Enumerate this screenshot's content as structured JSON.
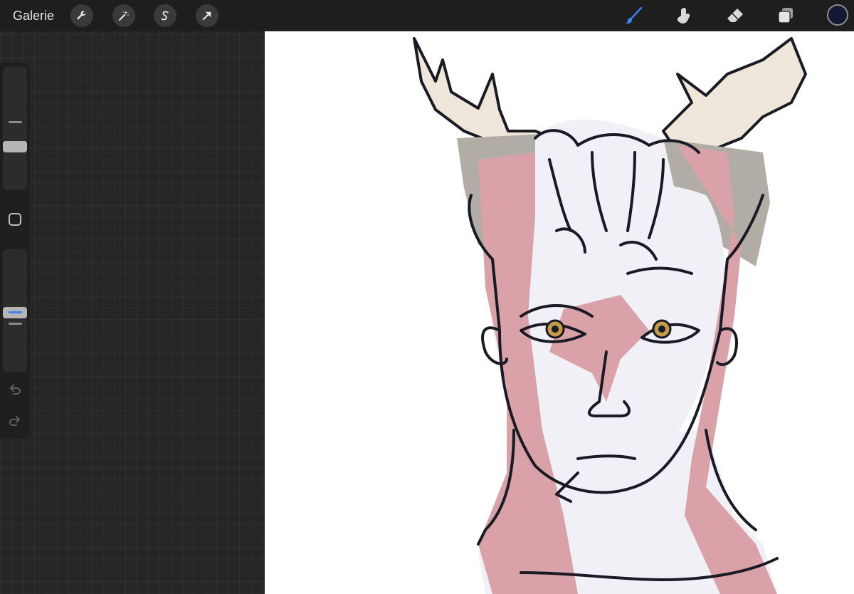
{
  "topbar": {
    "gallery_label": "Galerie",
    "left_tools": [
      {
        "name": "actions-wrench-icon"
      },
      {
        "name": "adjustments-magic-wand-icon"
      },
      {
        "name": "selection-s-icon"
      },
      {
        "name": "transform-arrow-icon"
      }
    ],
    "right_tools": [
      {
        "name": "brush-icon",
        "active": true
      },
      {
        "name": "smudge-icon"
      },
      {
        "name": "eraser-icon"
      },
      {
        "name": "layers-icon"
      }
    ],
    "current_color": "#141933"
  },
  "sidebar": {
    "brush_size_level": 0.35,
    "opacity_level": 0.48,
    "icons": [
      "undo-icon",
      "redo-icon"
    ]
  },
  "colors": {
    "accent": "#3d84f7",
    "skin_pink": "#d9a2a8",
    "antler": "#efe6da",
    "hair_grey": "#b1ada6",
    "face_light": "#f1f0f7",
    "line": "#1a1a24",
    "eye": "#c59a4a"
  }
}
